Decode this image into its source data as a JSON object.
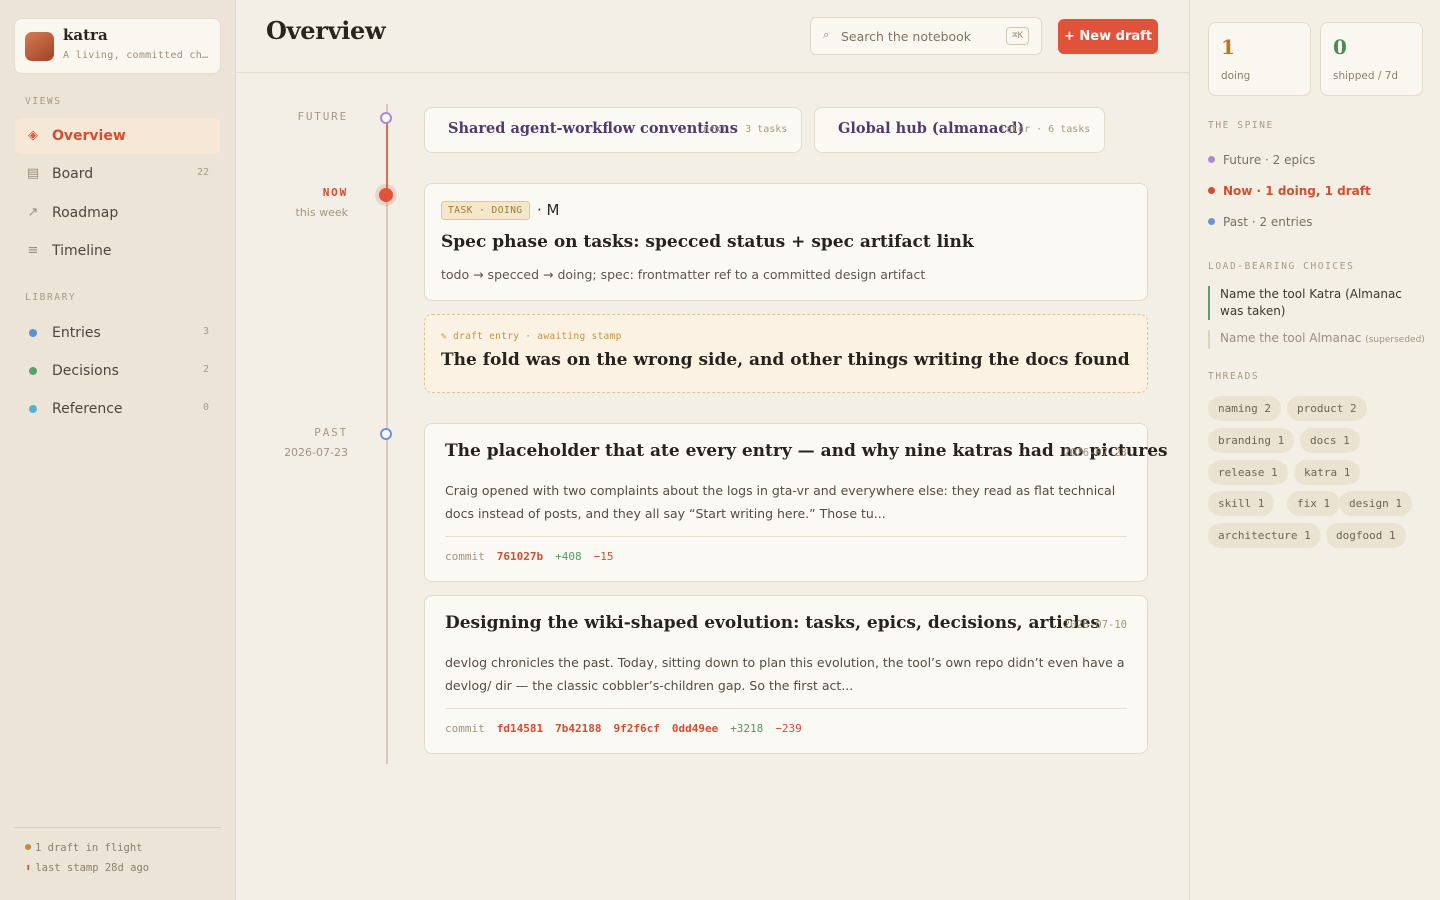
{
  "sidebar": {
    "brand": {
      "name": "katra",
      "subtitle": "A living, committed chronicle"
    },
    "views_label": "VIEWS",
    "views": [
      {
        "label": "Overview",
        "icon": "diamond-icon",
        "count": ""
      },
      {
        "label": "Board",
        "icon": "board-icon",
        "count": "22"
      },
      {
        "label": "Roadmap",
        "icon": "arrow-up-right-icon",
        "count": ""
      },
      {
        "label": "Timeline",
        "icon": "lines-icon",
        "count": ""
      }
    ],
    "library_label": "LIBRARY",
    "library": [
      {
        "label": "Entries",
        "count": "3",
        "color": "#5b8fd6"
      },
      {
        "label": "Decisions",
        "count": "2",
        "color": "#58a26a"
      },
      {
        "label": "Reference",
        "count": "0",
        "color": "#54b3cf"
      }
    ],
    "footer": {
      "draft": "1 draft in flight",
      "stamp": "last stamp 28d ago"
    }
  },
  "header": {
    "title": "Overview",
    "search_placeholder": "Search the notebook",
    "search_shortcut": "⌘K",
    "new_button": "+ New draft"
  },
  "timeline": {
    "future": {
      "label": "FUTURE",
      "epics": [
        {
          "title": "Shared agent-workflow conventions",
          "meta": "next · 3 tasks"
        },
        {
          "title": "Global hub (almanacd)",
          "meta": "later · 6 tasks"
        }
      ]
    },
    "now": {
      "label": "NOW",
      "sub": "this week",
      "task": {
        "badge": "TASK · DOING",
        "size": "· M",
        "title": "Spec phase on tasks: specced status + spec artifact link",
        "desc": "todo → specced → doing; spec: frontmatter ref to a committed design artifact"
      },
      "draft": {
        "meta": "✎ draft entry · awaiting stamp",
        "title": "The fold was on the wrong side, and other things writing the docs found"
      }
    },
    "past": {
      "label": "PAST",
      "sub": "2026-07-23",
      "entries": [
        {
          "title": "The placeholder that ate every entry — and why nine katras had no pictures",
          "date": "2026-07-23",
          "body": "Craig opened with two complaints about the logs in gta-vr and everywhere else: they read as flat technical docs instead of posts, and they all say “Start writing here.” Those tu...",
          "commit_label": "commit",
          "hashes": [
            "761027b"
          ],
          "additions": "+408",
          "deletions": "−15"
        },
        {
          "title": "Designing the wiki-shaped evolution: tasks, epics, decisions, articles",
          "date": "2026-07-10",
          "body": "devlog chronicles the past. Today, sitting down to plan this evolution, the tool’s own repo didn’t even have a devlog/ dir — the classic cobbler’s-children gap. So the first act...",
          "commit_label": "commit",
          "hashes": [
            "fd14581",
            "7b42188",
            "9f2f6cf",
            "0dd49ee"
          ],
          "additions": "+3218",
          "deletions": "−239"
        }
      ]
    }
  },
  "right_panel": {
    "stats": [
      {
        "value": "1",
        "label": "doing",
        "color": "#b7782a"
      },
      {
        "value": "0",
        "label": "shipped / 7d",
        "color": "#4f8a5a"
      }
    ],
    "spine_label": "THE SPINE",
    "spine": [
      {
        "text": "Future · 2 epics",
        "color": "#a98ad6"
      },
      {
        "text": "Now · 1 doing, 1 draft",
        "color": "#d24e30"
      },
      {
        "text": "Past · 2 entries",
        "color": "#6b93d6"
      }
    ],
    "choices_label": "LOAD-BEARING CHOICES",
    "choices": [
      {
        "text": "Name the tool Katra (Almanac was taken)",
        "note": ""
      },
      {
        "text": "Name the tool Almanac",
        "note": "(superseded)"
      }
    ],
    "threads_label": "THREADS",
    "threads": [
      "naming 2",
      "product 2",
      "branding 1",
      "docs 1",
      "release 1",
      "katra 1",
      "skill 1",
      "fix 1",
      "design 1",
      "architecture 1",
      "dogfood 1"
    ]
  }
}
